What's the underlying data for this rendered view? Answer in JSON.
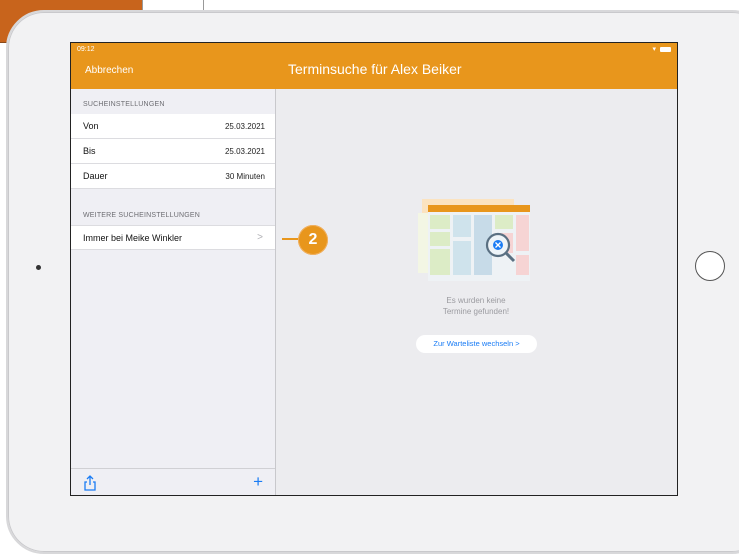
{
  "status_bar": {
    "time": "09:12",
    "wifi_icon": "wifi-icon",
    "battery_icon": "battery-icon"
  },
  "navbar": {
    "cancel_label": "Abbrechen",
    "title": "Terminsuche für Alex Beiker",
    "color": "#e8961c"
  },
  "search_settings": {
    "header": "SUCHEINSTELLUNGEN",
    "rows": [
      {
        "label": "Von",
        "value": "25.03.2021"
      },
      {
        "label": "Bis",
        "value": "25.03.2021"
      },
      {
        "label": "Dauer",
        "value": "30 Minuten"
      }
    ]
  },
  "more_settings": {
    "header": "WEITERE SUCHEINSTELLUNGEN",
    "rows": [
      {
        "label": "Immer bei Meike Winkler",
        "chevron": ">"
      }
    ]
  },
  "toolbar": {
    "share_icon": "share-icon",
    "add_icon": "+",
    "accent": "#1a7cf5"
  },
  "detail": {
    "empty_line1": "Es wurden keine",
    "empty_line2": "Termine gefunden!",
    "waitlist_button": "Zur Warteliste wechseln >"
  },
  "callout": {
    "number": "2"
  }
}
